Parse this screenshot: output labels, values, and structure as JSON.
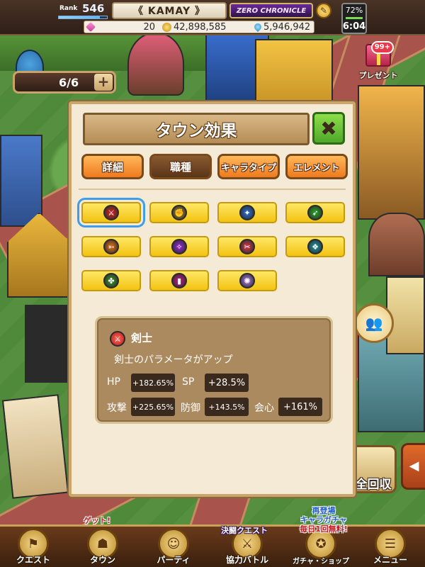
{
  "status_bar": {
    "rank_label": "Rank",
    "rank_value": "546",
    "xp_fill": 0.85,
    "player_name": "《 KAMAY 》",
    "game_title": "ZERO CHRONICLE",
    "gems": "20",
    "gold": "42,898,585",
    "drops": "5,946,942",
    "battery": "72%",
    "time": "6:04"
  },
  "team": {
    "count": "6/6",
    "plus": "+"
  },
  "present": {
    "label": "プレゼント",
    "badge": "99+"
  },
  "collect": {
    "label": "全回収"
  },
  "modal": {
    "title": "タウン効果",
    "close": "✖",
    "tabs": [
      {
        "label": "詳細"
      },
      {
        "label": "職種"
      },
      {
        "label": "キャラタイプ"
      },
      {
        "label": "エレメント"
      }
    ]
  },
  "job_icons": [
    {
      "icon": "sword-icon",
      "glyph": "⚔",
      "color": "#d8251d"
    },
    {
      "icon": "fist-icon",
      "glyph": "✊",
      "color": "#a88a2a"
    },
    {
      "icon": "axe-icon",
      "glyph": "✦",
      "color": "#2a72d8"
    },
    {
      "icon": "spear-icon",
      "glyph": "➶",
      "color": "#2aa82a"
    },
    {
      "icon": "bow-icon",
      "glyph": "➳",
      "color": "#e8721a"
    },
    {
      "icon": "magic-icon",
      "glyph": "✧",
      "color": "#9a2ad8"
    },
    {
      "icon": "dagger-icon",
      "glyph": "✂",
      "color": "#d83a4a"
    },
    {
      "icon": "bird-icon",
      "glyph": "❖",
      "color": "#1a9aa8"
    },
    {
      "icon": "claw-icon",
      "glyph": "✤",
      "color": "#3a9a2a"
    },
    {
      "icon": "book-icon",
      "glyph": "▮",
      "color": "#c81a8a"
    },
    {
      "icon": "special-icon",
      "glyph": "✺",
      "color": "#b07ae8"
    }
  ],
  "info": {
    "title": "剣士",
    "description": "剣士のパラメータがアップ",
    "hp_label": "HP",
    "hp_value": "+182.65%",
    "sp_label": "SP",
    "sp_value": "+28.5%",
    "atk_label": "攻撃",
    "atk_value": "+225.65%",
    "def_label": "防御",
    "def_value": "+143.5%",
    "crit_label": "会心",
    "crit_value": "+161%"
  },
  "bottom_nav": {
    "items": [
      {
        "label": "クエスト",
        "icon": "quest-icon",
        "glyph": "⚑"
      },
      {
        "label": "タウン",
        "icon": "town-icon",
        "glyph": "☗"
      },
      {
        "label": "パーティ",
        "icon": "party-icon",
        "glyph": "☺"
      },
      {
        "label": "協力バトル",
        "icon": "coop-battle-icon",
        "glyph": "⚔"
      },
      {
        "label": "ガチャ・ショップ",
        "icon": "gacha-icon",
        "glyph": "✪"
      },
      {
        "label": "メニュー",
        "icon": "menu-icon",
        "glyph": "☰"
      }
    ],
    "town_tag": "ゲット!",
    "coop_tag": "決闘クエスト",
    "gacha_tag_line1": "再登場",
    "gacha_tag_line2": "キャラガチャ",
    "gacha_tag_line3": "毎日1回無料!"
  }
}
